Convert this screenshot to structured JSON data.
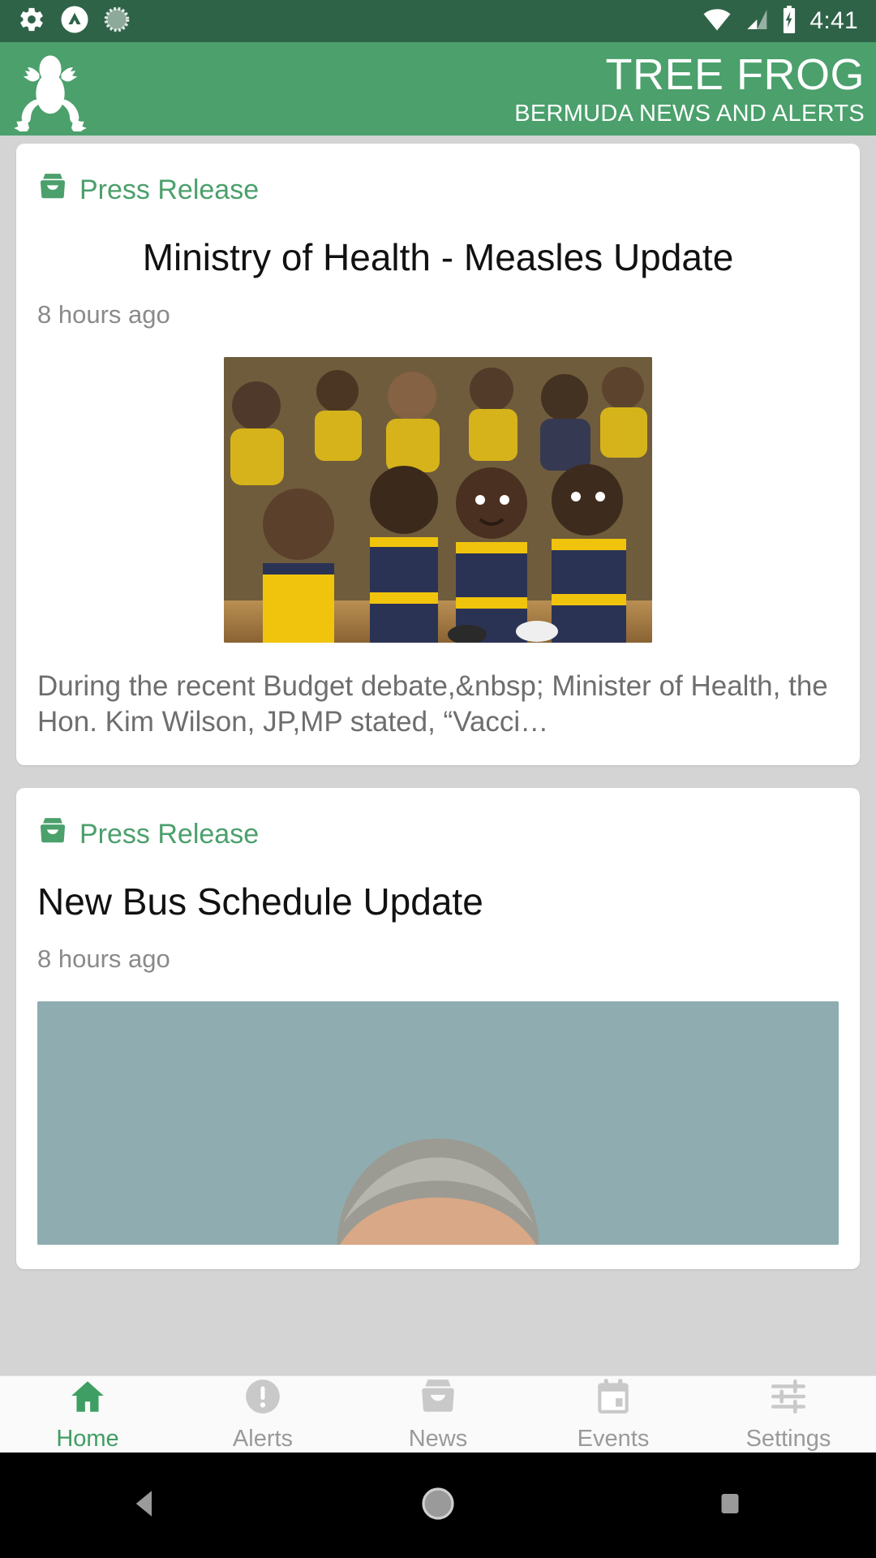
{
  "status_bar": {
    "time": "4:41",
    "icons_left": [
      "gear-icon",
      "caret-up-circle-icon",
      "sync-progress-icon"
    ],
    "icons_right": [
      "wifi-icon",
      "cell-signal-icon",
      "battery-charging-icon"
    ]
  },
  "header": {
    "logo": "tree-frog-logo",
    "title": "TREE FROG",
    "subtitle": "BERMUDA NEWS AND ALERTS",
    "bg_color": "#4ba06c"
  },
  "feed": {
    "cards": [
      {
        "kicker_icon": "inbox-tray-icon",
        "kicker": "Press Release",
        "headline": "Ministry of Health - Measles Update",
        "headline_align": "center",
        "timestamp": "8 hours ago",
        "image": "children-in-school-uniforms-photo",
        "excerpt": "During the recent Budget debate,&nbsp; Minister of Health, the Hon. Kim Wilson, JP,MP stated, “Vacci…"
      },
      {
        "kicker_icon": "inbox-tray-icon",
        "kicker": "Press Release",
        "headline": "New Bus Schedule Update",
        "headline_align": "left",
        "timestamp": "8 hours ago",
        "image": "portrait-of-man-photo",
        "excerpt": ""
      }
    ]
  },
  "tabbar": {
    "active": "Home",
    "active_color": "#3f9e63",
    "inactive_color": "#9a9a9a",
    "items": [
      {
        "label": "Home",
        "icon": "home-icon"
      },
      {
        "label": "Alerts",
        "icon": "alert-circle-icon"
      },
      {
        "label": "News",
        "icon": "inbox-tray-icon"
      },
      {
        "label": "Events",
        "icon": "calendar-icon"
      },
      {
        "label": "Settings",
        "icon": "sliders-icon"
      }
    ]
  },
  "android_nav": {
    "back": "back-triangle-icon",
    "home": "home-circle-icon",
    "recents": "recents-square-icon"
  }
}
